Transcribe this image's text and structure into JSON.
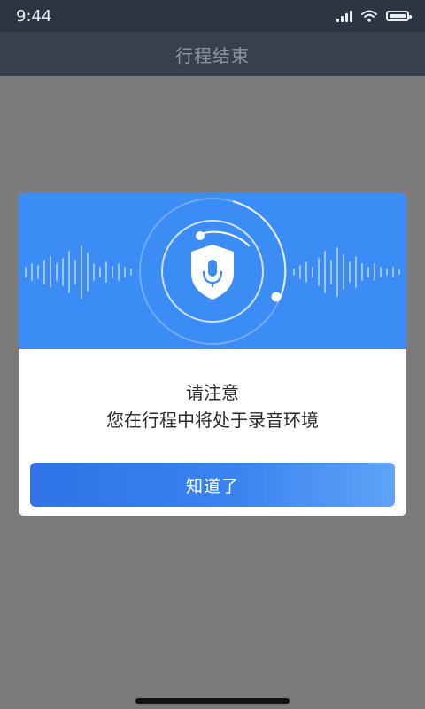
{
  "status_bar": {
    "time": "9:44",
    "icons": [
      "signal-icon",
      "wifi-icon",
      "battery-icon"
    ]
  },
  "nav_bar": {
    "title": "行程结束"
  },
  "dialog": {
    "hero_icon": "shield-microphone-icon",
    "message_line1": "请注意",
    "message_line2": "您在行程中将处于录音环境",
    "confirm_label": "知道了"
  },
  "colors": {
    "status_bar_bg": "#2f3442",
    "nav_bar_bg": "#3a3f4c",
    "overlay_bg": "#7b7b7b",
    "hero_blue": "#3b8cf5",
    "button_start": "#2f73e6",
    "button_end": "#5ea3f7"
  }
}
